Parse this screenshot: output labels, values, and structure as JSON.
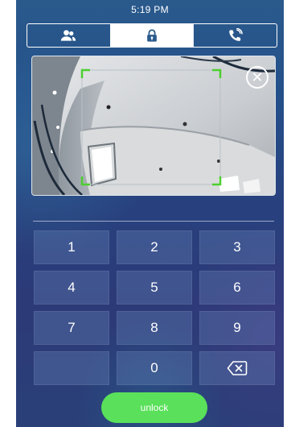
{
  "status_bar": {
    "time": "5:19 PM"
  },
  "tabs": [
    {
      "icon": "contacts-icon",
      "active": false
    },
    {
      "icon": "lock-icon",
      "active": true
    },
    {
      "icon": "phone-call-icon",
      "active": false
    }
  ],
  "camera": {
    "close_icon": "close-icon"
  },
  "keypad": {
    "keys": [
      "1",
      "2",
      "3",
      "4",
      "5",
      "6",
      "7",
      "8",
      "9",
      "",
      "0"
    ],
    "backspace_icon": "backspace-icon"
  },
  "unlock_label": "unlock",
  "colors": {
    "accent_green": "#5ae05a",
    "focus_bracket": "#4ccf2e",
    "background_top": "#2a5a8c",
    "background_bottom": "#2a3f78"
  }
}
